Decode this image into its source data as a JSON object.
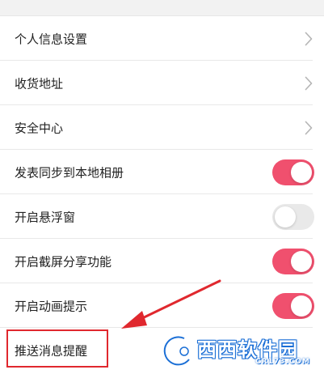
{
  "settings": {
    "items": [
      {
        "label": "个人信息设置",
        "control": "chevron"
      },
      {
        "label": "收货地址",
        "control": "chevron"
      },
      {
        "label": "安全中心",
        "control": "chevron"
      },
      {
        "label": "发表同步到本地相册",
        "control": "toggle",
        "on": true
      },
      {
        "label": "开启悬浮窗",
        "control": "toggle",
        "on": false
      },
      {
        "label": "开启截屏分享功能",
        "control": "toggle",
        "on": true
      },
      {
        "label": "开启动画提示",
        "control": "toggle",
        "on": true
      },
      {
        "label": "推送消息提醒",
        "control": "none"
      }
    ]
  },
  "annotation": {
    "color": "#e0282e",
    "highlighted_item": "推送消息提醒"
  },
  "watermark": {
    "logo_icon": "cr-logo-icon",
    "brand": "西西软件园",
    "url": "CR173.COM",
    "color": "#1b6fd6"
  },
  "colors": {
    "toggle_on": "#f0506e",
    "toggle_off": "#e9e9e9",
    "chevron": "#b5b5b5"
  }
}
